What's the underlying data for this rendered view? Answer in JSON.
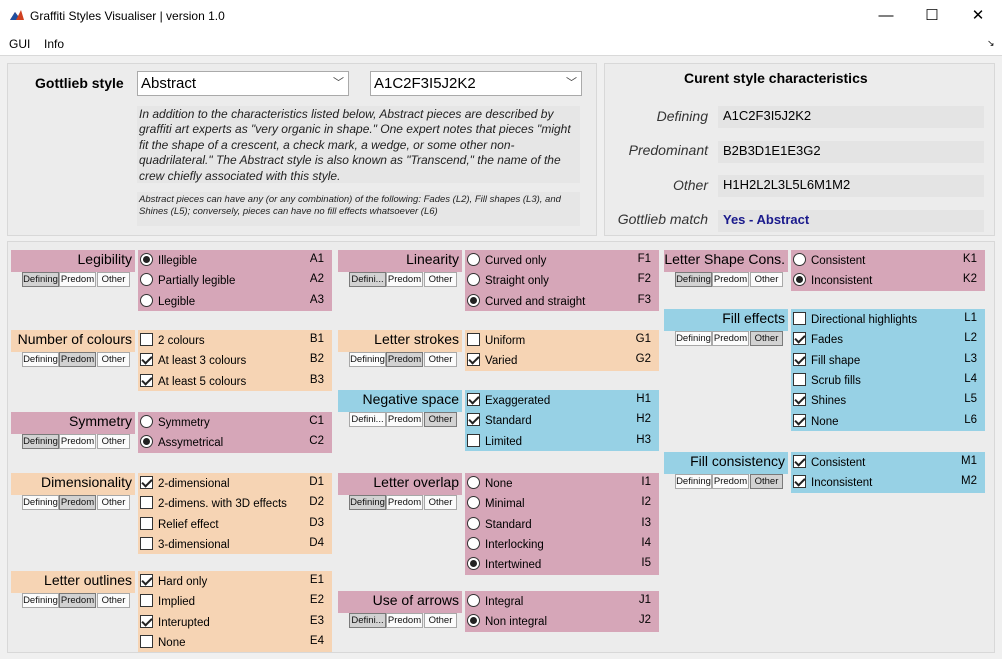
{
  "window": {
    "title": "Graffiti Styles Visualiser | version 1.0",
    "minimize": "—",
    "maximize": "☐",
    "close": "✕",
    "corner": "↘"
  },
  "menu": {
    "gui": "GUI",
    "info": "Info"
  },
  "top": {
    "gottlieb_label": "Gottlieb style",
    "style_select": "Abstract",
    "code_select": "A1C2F3I5J2K2",
    "description": "In addition to the characteristics listed below, Abstract pieces are described by graffiti art experts as \"very organic in shape.\" One expert notes that pieces \"might fit the shape of a crescent, a check mark, a wedge, or some other non-quadrilateral.\" The Abstract style is also known as \"Transcend,\" the name of the crew chiefly associated with this style.",
    "note": "Abstract pieces can have any (or any combination) of the following: Fades (L2), Fill shapes (L3), and Shines (L5); conversely, pieces can have no fill effects whatsoever (L6)"
  },
  "current": {
    "title": "Curent style characteristics",
    "defining_label": "Defining",
    "defining_value": "A1C2F3I5J2K2",
    "predominant_label": "Predominant",
    "predominant_value": "B2B3D1E1E3G2",
    "other_label": "Other",
    "other_value": "H1H2L2L3L5L6M1M2",
    "match_label": "Gottlieb match",
    "match_value": "Yes - Abstract"
  },
  "colors": {
    "pink": "#d6a6b8",
    "peach": "#f6d4b4",
    "blue": "#97d1e5",
    "match": "#1a1a8c"
  },
  "groups": [
    {
      "title": "Legibility",
      "color": "pink",
      "type": "radio",
      "toggles": [
        "Defining",
        "Predom",
        "Other"
      ],
      "active": 0,
      "options": [
        {
          "label": "Illegible",
          "code": "A1",
          "on": true
        },
        {
          "label": "Partially legible",
          "code": "A2",
          "on": false
        },
        {
          "label": "Legible",
          "code": "A3",
          "on": false
        }
      ]
    },
    {
      "title": "Number of colours",
      "color": "peach",
      "type": "check",
      "toggles": [
        "Defining",
        "Predom",
        "Other"
      ],
      "active": 1,
      "options": [
        {
          "label": "2 colours",
          "code": "B1",
          "on": false
        },
        {
          "label": "At least 3 colours",
          "code": "B2",
          "on": true
        },
        {
          "label": "At least 5 colours",
          "code": "B3",
          "on": true
        }
      ]
    },
    {
      "title": "Symmetry",
      "color": "pink",
      "type": "radio",
      "toggles": [
        "Defining",
        "Predom",
        "Other"
      ],
      "active": 0,
      "options": [
        {
          "label": "Symmetry",
          "code": "C1",
          "on": false
        },
        {
          "label": "Assymetrical",
          "code": "C2",
          "on": true
        }
      ]
    },
    {
      "title": "Dimensionality",
      "color": "peach",
      "type": "check",
      "toggles": [
        "Defining",
        "Predom",
        "Other"
      ],
      "active": 1,
      "options": [
        {
          "label": "2-dimensional",
          "code": "D1",
          "on": true
        },
        {
          "label": "2-dimens. with 3D effects",
          "code": "D2",
          "on": false
        },
        {
          "label": "Relief effect",
          "code": "D3",
          "on": false
        },
        {
          "label": "3-dimensional",
          "code": "D4",
          "on": false
        }
      ]
    },
    {
      "title": "Letter outlines",
      "color": "peach",
      "type": "check",
      "toggles": [
        "Defining",
        "Predom",
        "Other"
      ],
      "active": 1,
      "options": [
        {
          "label": "Hard only",
          "code": "E1",
          "on": true
        },
        {
          "label": "Implied",
          "code": "E2",
          "on": false
        },
        {
          "label": "Interupted",
          "code": "E3",
          "on": true
        },
        {
          "label": "None",
          "code": "E4",
          "on": false
        }
      ]
    },
    {
      "title": "Linearity",
      "color": "pink",
      "type": "radio",
      "toggles": [
        "Defini...",
        "Predom",
        "Other"
      ],
      "active": 0,
      "options": [
        {
          "label": "Curved only",
          "code": "F1",
          "on": false
        },
        {
          "label": "Straight only",
          "code": "F2",
          "on": false
        },
        {
          "label": "Curved and straight",
          "code": "F3",
          "on": true
        }
      ]
    },
    {
      "title": "Letter strokes",
      "color": "peach",
      "type": "check",
      "toggles": [
        "Defining",
        "Predom",
        "Other"
      ],
      "active": 1,
      "options": [
        {
          "label": "Uniform",
          "code": "G1",
          "on": false
        },
        {
          "label": "Varied",
          "code": "G2",
          "on": true
        }
      ]
    },
    {
      "title": "Negative space",
      "color": "blue",
      "type": "check",
      "toggles": [
        "Defini...",
        "Predom",
        "Other"
      ],
      "active": 2,
      "options": [
        {
          "label": "Exaggerated",
          "code": "H1",
          "on": true
        },
        {
          "label": "Standard",
          "code": "H2",
          "on": true
        },
        {
          "label": "Limited",
          "code": "H3",
          "on": false
        }
      ]
    },
    {
      "title": "Letter overlap",
      "color": "pink",
      "type": "radio",
      "toggles": [
        "Defining",
        "Predom",
        "Other"
      ],
      "active": 0,
      "options": [
        {
          "label": "None",
          "code": "I1",
          "on": false
        },
        {
          "label": "Minimal",
          "code": "I2",
          "on": false
        },
        {
          "label": "Standard",
          "code": "I3",
          "on": false
        },
        {
          "label": "Interlocking",
          "code": "I4",
          "on": false
        },
        {
          "label": "Intertwined",
          "code": "I5",
          "on": true
        }
      ]
    },
    {
      "title": "Use of arrows",
      "color": "pink",
      "type": "radio",
      "toggles": [
        "Defini...",
        "Predom",
        "Other"
      ],
      "active": 0,
      "options": [
        {
          "label": "Integral",
          "code": "J1",
          "on": false
        },
        {
          "label": "Non integral",
          "code": "J2",
          "on": true
        }
      ]
    },
    {
      "title": "Letter Shape Cons.",
      "color": "pink",
      "type": "radio",
      "toggles": [
        "Defining",
        "Predom",
        "Other"
      ],
      "active": 0,
      "options": [
        {
          "label": "Consistent",
          "code": "K1",
          "on": false
        },
        {
          "label": "Inconsistent",
          "code": "K2",
          "on": true
        }
      ]
    },
    {
      "title": "Fill effects",
      "color": "blue",
      "type": "check",
      "toggles": [
        "Defining",
        "Predom",
        "Other"
      ],
      "active": 2,
      "options": [
        {
          "label": "Directional highlights",
          "code": "L1",
          "on": false
        },
        {
          "label": "Fades",
          "code": "L2",
          "on": true
        },
        {
          "label": "Fill shape",
          "code": "L3",
          "on": true
        },
        {
          "label": "Scrub fills",
          "code": "L4",
          "on": false
        },
        {
          "label": "Shines",
          "code": "L5",
          "on": true
        },
        {
          "label": "None",
          "code": "L6",
          "on": true
        }
      ]
    },
    {
      "title": "Fill consistency",
      "color": "blue",
      "type": "check",
      "toggles": [
        "Defining",
        "Predom",
        "Other"
      ],
      "active": 2,
      "options": [
        {
          "label": "Consistent",
          "code": "M1",
          "on": true
        },
        {
          "label": "Inconsistent",
          "code": "M2",
          "on": true
        }
      ]
    }
  ]
}
